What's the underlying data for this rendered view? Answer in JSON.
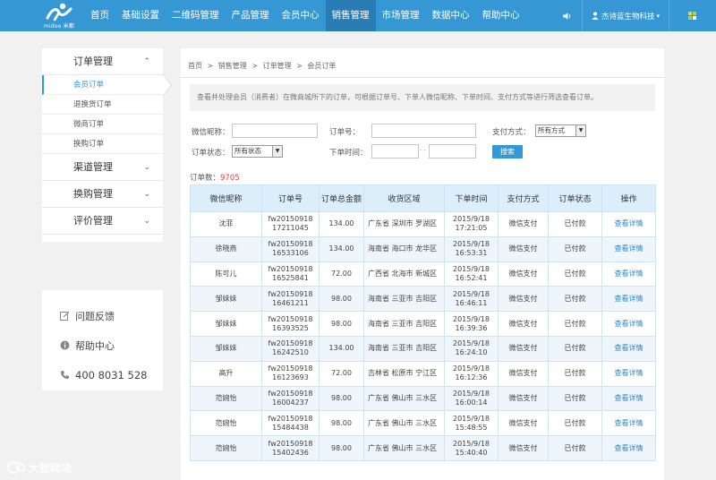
{
  "brand": {
    "wordmark": "midoo 米都"
  },
  "nav": {
    "items": [
      "首页",
      "基础设置",
      "二维码管理",
      "产品管理",
      "会员中心",
      "销售管理",
      "市场管理",
      "数据中心",
      "帮助中心"
    ],
    "active_index": 5
  },
  "topright": {
    "user_name": "杰诗蓝生物科技",
    "caret": "▾"
  },
  "sidebar": {
    "groups": [
      {
        "label": "订单管理",
        "chevron": "⌃",
        "items": [
          "会员订单",
          "退换货订单",
          "微商订单",
          "换购订单"
        ]
      },
      {
        "label": "渠道管理",
        "chevron": "⌄"
      },
      {
        "label": "换购管理",
        "chevron": "⌄"
      },
      {
        "label": "评价管理",
        "chevron": "⌄"
      }
    ],
    "active_item": "会员订单"
  },
  "help": {
    "feedback": "问题反馈",
    "center": "帮助中心",
    "phone": "400 8031 528"
  },
  "breadcrumb": [
    "首页",
    ">",
    "销售管理",
    ">",
    "订单管理",
    ">",
    "会员订单"
  ],
  "notice": "查看并处理会员（消费者）在微商城所下的订单，可根据订单号、下单人微信昵称、下单时间、支付方式等进行筛选查看订单。",
  "filters": {
    "wechat_label": "微信昵称：",
    "order_no_label": "订单号：",
    "pay_label": "支付方式：",
    "pay_value": "所有方式",
    "status_label": "订单状态：",
    "status_value": "所有状态",
    "time_label": "下单时间：",
    "time_sep": "- -",
    "search_btn": "搜索"
  },
  "count": {
    "label": "订单数：",
    "value": "9705"
  },
  "table": {
    "headers": [
      "微信昵称",
      "订单号",
      "订单总金额",
      "收货区域",
      "下单时间",
      "支付方式",
      "订单状态",
      "操作"
    ],
    "rows": [
      [
        "沈菲",
        "fw20150918 17211045",
        "134.00",
        "广东省 深圳市 罗湖区",
        "2015/9/18 17:21:05",
        "微信支付",
        "已付款",
        "查看详情"
      ],
      [
        "徐晓燕",
        "fw20150918 16533106",
        "134.00",
        "海南省 海口市 龙华区",
        "2015/9/18 16:53:31",
        "微信支付",
        "已付款",
        "查看详情"
      ],
      [
        "陈可儿",
        "fw20150918 16525841",
        "72.00",
        "广西省 北海市 新城区",
        "2015/9/18 16:52:41",
        "微信支付",
        "已付款",
        "查看详情"
      ],
      [
        "邹妹妹",
        "fw20150918 16461211",
        "98.00",
        "海南省 三亚市 吉阳区",
        "2015/9/18 16:46:11",
        "微信支付",
        "已付款",
        "查看详情"
      ],
      [
        "邹妹妹",
        "fw20150918 16393525",
        "98.00",
        "海南省 三亚市 吉阳区",
        "2015/9/18 16:39:36",
        "微信支付",
        "已付款",
        "查看详情"
      ],
      [
        "邹妹妹",
        "fw20150918 16242510",
        "134.00",
        "海南省 三亚市 吉阳区",
        "2015/9/18 16:24:10",
        "微信支付",
        "已付款",
        "查看详情"
      ],
      [
        "高升",
        "fw20150918 16123693",
        "72.00",
        "吉林省 松原市 宁江区",
        "2015/9/18 16:12:36",
        "微信支付",
        "已付款",
        "查看详情"
      ],
      [
        "范婉怡",
        "fw20150918 16004237",
        "98.00",
        "广东省 佛山市 三水区",
        "2015/9/18 16:00:14",
        "微信支付",
        "已付款",
        "查看详情"
      ],
      [
        "范婉怡",
        "fw20150918 15484438",
        "98.00",
        "广东省 佛山市 三水区",
        "2015/9/18 15:48:55",
        "微信支付",
        "已付款",
        "查看详情"
      ],
      [
        "范婉怡",
        "fw20150918 15402436",
        "98.00",
        "广东省 佛山市 三水区",
        "2015/9/18 15:40:40",
        "微信支付",
        "已付款",
        "查看详情"
      ]
    ]
  },
  "watermark": {
    "text": "大数跨境"
  },
  "colors": {
    "nav_bg": "#3597d3",
    "nav_active": "#2a7db4",
    "accent": "#3597d3",
    "count_red": "#e43b3b",
    "header_bg": "#dbeefa"
  }
}
